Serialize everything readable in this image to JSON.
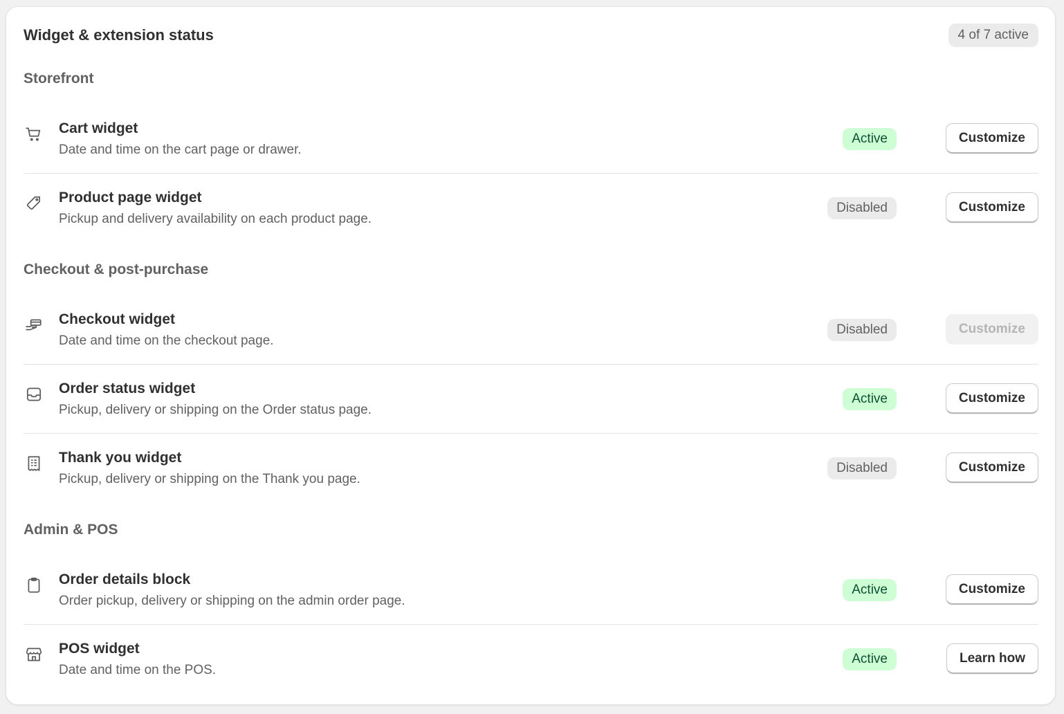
{
  "header": {
    "title": "Widget & extension status",
    "count_badge": "4 of 7 active"
  },
  "sections": [
    {
      "title": "Storefront",
      "items": [
        {
          "name": "Cart widget",
          "description": "Date and time on the cart page or drawer.",
          "icon": "cart-icon",
          "status": "Active",
          "action": "Customize"
        },
        {
          "name": "Product page widget",
          "description": "Pickup and delivery availability on each product page.",
          "icon": "tag-icon",
          "status": "Disabled",
          "action": "Customize"
        }
      ]
    },
    {
      "title": "Checkout & post-purchase",
      "items": [
        {
          "name": "Checkout widget",
          "description": "Date and time on the checkout page.",
          "icon": "hand-card-icon",
          "status": "Disabled",
          "action": "Customize",
          "action_disabled": true
        },
        {
          "name": "Order status widget",
          "description": "Pickup, delivery or shipping on the Order status page.",
          "icon": "inbox-icon",
          "status": "Active",
          "action": "Customize"
        },
        {
          "name": "Thank you widget",
          "description": "Pickup, delivery or shipping on the Thank you page.",
          "icon": "receipt-icon",
          "status": "Disabled",
          "action": "Customize"
        }
      ]
    },
    {
      "title": "Admin & POS",
      "items": [
        {
          "name": "Order details block",
          "description": "Order pickup, delivery or shipping on the admin order page.",
          "icon": "clipboard-icon",
          "status": "Active",
          "action": "Customize"
        },
        {
          "name": "POS widget",
          "description": "Date and time on the POS.",
          "icon": "store-icon",
          "status": "Active",
          "action": "Learn how"
        }
      ]
    }
  ],
  "colors": {
    "active_bg": "#cdfed4",
    "active_text": "#0c5132",
    "disabled_bg": "#ebebeb",
    "disabled_text": "#616161"
  }
}
